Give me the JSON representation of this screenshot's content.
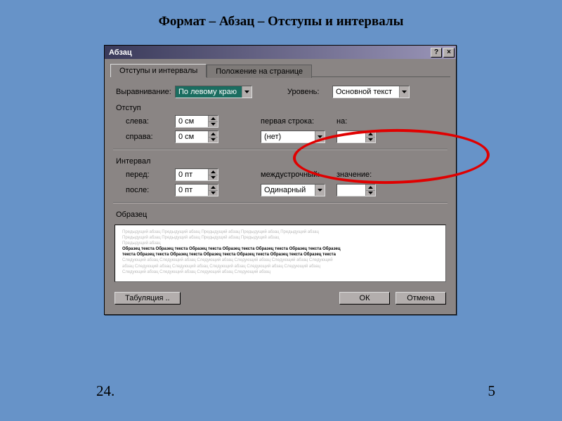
{
  "slide_title": "Формат – Абзац – Отступы и интервалы",
  "dialog": {
    "title": "Абзац",
    "help_btn": "?",
    "close_btn": "×",
    "tabs": {
      "active": "Отступы и интервалы",
      "inactive": "Положение на странице"
    },
    "alignment": {
      "label": "Выравнивание:",
      "value": "По левому краю"
    },
    "level": {
      "label": "Уровень:",
      "value": "Основной текст"
    },
    "indent": {
      "group": "Отступ",
      "left_label": "слева:",
      "left_value": "0 см",
      "right_label": "справа:",
      "right_value": "0 см",
      "firstline_label": "первая строка:",
      "firstline_value": "(нет)",
      "by_label": "на:",
      "by_value": ""
    },
    "spacing": {
      "group": "Интервал",
      "before_label": "перед:",
      "before_value": "0 пт",
      "after_label": "после:",
      "after_value": "0 пт",
      "line_label": "междустрочный:",
      "line_value": "Одинарный",
      "at_label": "значение:",
      "at_value": ""
    },
    "preview": {
      "label": "Образец",
      "line1": "Предыдущий абзац Предыдущий абзац Предыдущий абзац Предыдущий абзац Предыдущий абзац",
      "line2": "Предыдущий абзац Предыдущий абзац Предыдущий абзац Предыдущий абзац",
      "line3": "Предыдущий абзац",
      "line4": "Образец текста Образец текста Образец текста Образец текста Образец текста Образец текста Образец",
      "line5": "текста Образец текста Образец текста Образец текста Образец текста Образец текста Образец текста",
      "line6": "Следующий абзац Следующий абзац Следующий абзац Следующий абзац Следующий абзац Следующий",
      "line7": "абзац Следующий абзац Следующий абзац Следующий абзац Следующий абзац Следующий абзац",
      "line8": "Следующий абзац Следующий абзац Следующий абзац Следующий абзац"
    },
    "buttons": {
      "tabs": "Табуляция ..",
      "ok": "ОК",
      "cancel": "Отмена"
    }
  },
  "footer": {
    "left": "24.",
    "right": "5"
  }
}
